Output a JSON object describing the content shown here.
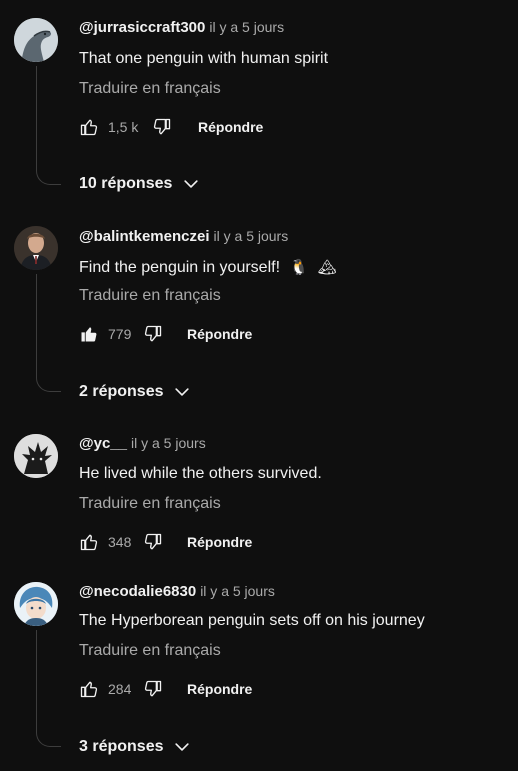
{
  "comments": [
    {
      "author": "@jurrasiccraft300",
      "time": "il y a 5 jours",
      "text": "That one penguin with human spirit",
      "translate": "Traduire en français",
      "likes": "1,5 k",
      "liked": false,
      "reply": "Répondre",
      "replies": "10 réponses"
    },
    {
      "author": "@balintkemenczei",
      "time": "il y a 5 jours",
      "text": "Find the penguin in yourself!",
      "emojis": [
        "🐧",
        "🏔"
      ],
      "translate": "Traduire en français",
      "likes": "779",
      "liked": true,
      "reply": "Répondre",
      "replies": "2 réponses"
    },
    {
      "author": "@yc__",
      "time": "il y a 5 jours",
      "text": "He lived while the others survived.",
      "translate": "Traduire en français",
      "likes": "348",
      "liked": false,
      "reply": "Répondre"
    },
    {
      "author": "@necodalie6830",
      "time": "il y a 5 jours",
      "text": "The Hyperborean penguin sets off on his journey",
      "translate": "Traduire en français",
      "likes": "284",
      "liked": false,
      "reply": "Répondre",
      "replies": "3 réponses"
    }
  ]
}
